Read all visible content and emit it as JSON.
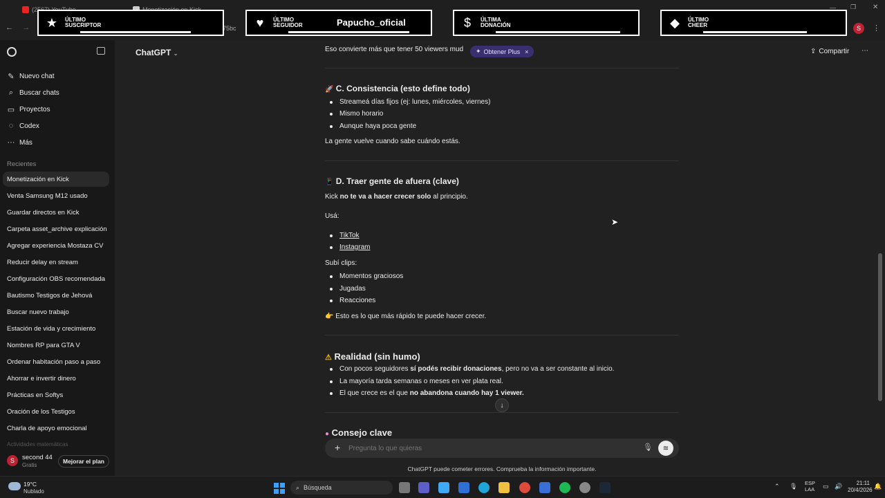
{
  "browser": {
    "tabs": [
      {
        "label": "(2567) YouTube"
      },
      {
        "label": "Monetización en Kick"
      }
    ],
    "url_fragment": "75bc",
    "profile_initial": "S"
  },
  "overlay": {
    "subscriber": {
      "line1": "ÚLTIMO",
      "line2": "SUSCRIPTOR"
    },
    "follower": {
      "line1": "ÚLTIMO",
      "line2": "SEGUIDOR",
      "name": "Papucho_oficial"
    },
    "donation": {
      "line1": "ÚLTIMA",
      "line2": "DONACIÓN"
    },
    "cheer": {
      "line1": "ÚLTIMO",
      "line2": "CHEER"
    }
  },
  "sidebar": {
    "nav": [
      {
        "label": "Nuevo chat",
        "icon": "edit-icon"
      },
      {
        "label": "Buscar chats",
        "icon": "search-icon"
      },
      {
        "label": "Proyectos",
        "icon": "folder-icon"
      },
      {
        "label": "Codex",
        "icon": "codex-icon"
      },
      {
        "label": "Más",
        "icon": "more-icon"
      }
    ],
    "recent_label": "Recientes",
    "recent": [
      "Monetización en Kick",
      "Venta Samsung M12 usado",
      "Guardar directos en Kick",
      "Carpeta asset_archive explicación",
      "Agregar experiencia Mostaza CV",
      "Reducir delay en stream",
      "Configuración OBS recomendada",
      "Bautismo Testigos de Jehová",
      "Buscar nuevo trabajo",
      "Estación de vida y crecimiento",
      "Nombres RP para GTA V",
      "Ordenar habitación paso a paso",
      "Ahorrar e invertir dinero",
      "Prácticas en Softys",
      "Oración de los Testigos",
      "Charla de apoyo emocional",
      "Actividades matemáticas"
    ],
    "user": {
      "initial": "S",
      "name": "second 44",
      "plan": "Gratis",
      "upgrade": "Mejorar el plan"
    }
  },
  "header": {
    "title": "ChatGPT",
    "plus_badge": "Obtener Plus",
    "share": "Compartir"
  },
  "message": {
    "line0": "Eso convierte más que tener 50 viewers mud",
    "sectionC": {
      "title": "C. Consistencia (esto define todo)",
      "items": [
        "Streameá días fijos (ej: lunes, miércoles, viernes)",
        "Mismo horario",
        "Aunque haya poca gente"
      ],
      "note": "La gente vuelve cuando sabe cuándo estás."
    },
    "sectionD": {
      "title": "D. Traer gente de afuera (clave)",
      "intro_a": "Kick ",
      "intro_b": "no te va a hacer crecer solo",
      "intro_c": " al principio.",
      "usa": "Usá:",
      "platforms": [
        "TikTok",
        "Instagram"
      ],
      "clips_label": "Subí clips:",
      "clips": [
        "Momentos graciosos",
        "Jugadas",
        "Reacciones"
      ],
      "tip": "Esto es lo que más rápido te puede hacer crecer."
    },
    "reality": {
      "title": "Realidad (sin humo)",
      "item1a": "Con pocos seguidores ",
      "item1b": "sí podés recibir donaciones",
      "item1c": ", pero no va a ser constante al inicio.",
      "item2": "La mayoría tarda semanas o meses en ver plata real.",
      "item3a": "El que crece es el que ",
      "item3b": "no abandona cuando hay 1 viewer."
    },
    "consejo": {
      "title": "Consejo clave"
    }
  },
  "composer": {
    "placeholder": "Pregunta lo que quieras",
    "disclaimer": "ChatGPT puede cometer errores. Comprueba la información importante."
  },
  "taskbar": {
    "weather_temp": "19°C",
    "weather_desc": "Nublado",
    "search": "Búsqueda",
    "lang1": "ESP",
    "lang2": "LAA",
    "time": "21:11",
    "date": "20/4/2026"
  },
  "colors": {
    "accent_plus": "#5b3fd6",
    "background": "#212121",
    "sidebar": "#181818"
  }
}
